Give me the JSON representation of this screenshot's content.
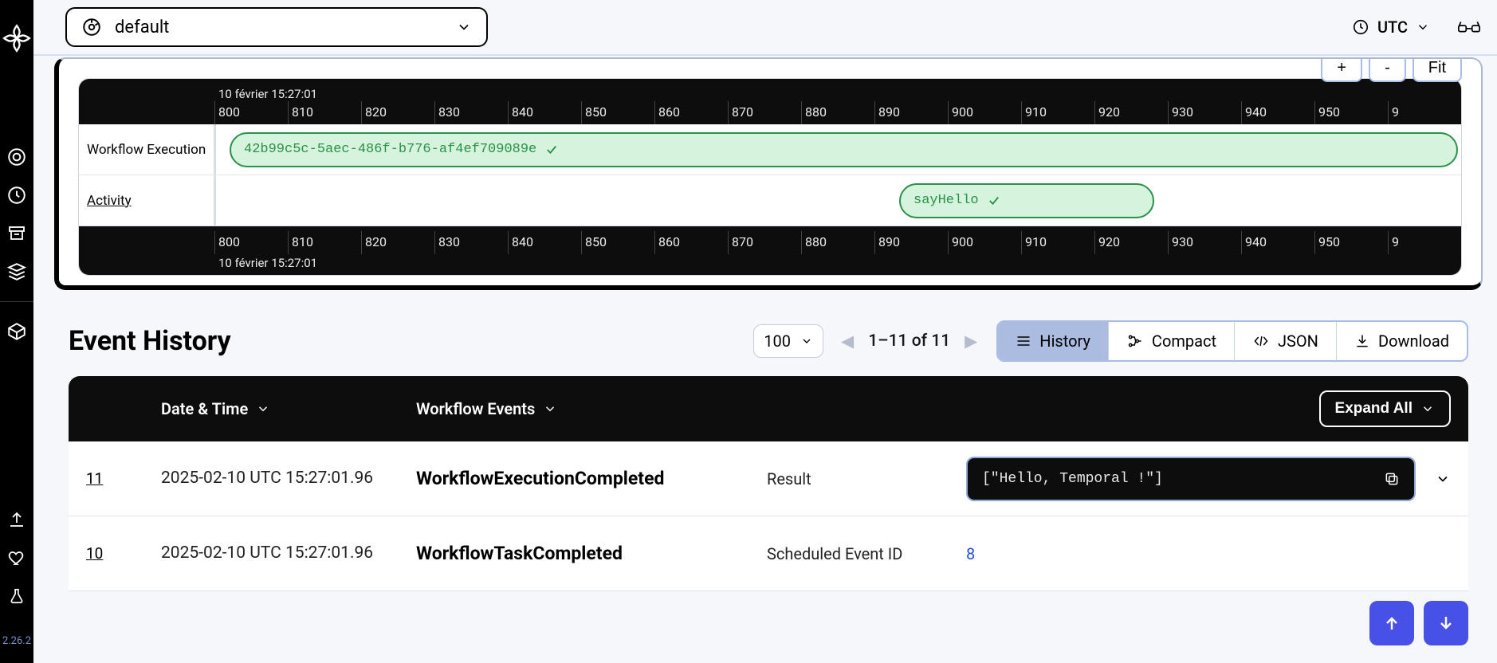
{
  "sidebar": {
    "version": "2.26.2"
  },
  "topbar": {
    "namespace": "default",
    "timezone": "UTC"
  },
  "zoom": {
    "plus": "+",
    "minus": "-",
    "fit": "Fit"
  },
  "timeline": {
    "date_label": "10 février 15:27:01",
    "ticks": [
      "800",
      "810",
      "820",
      "830",
      "840",
      "850",
      "860",
      "870",
      "880",
      "890",
      "900",
      "910",
      "920",
      "930",
      "940",
      "950",
      "9"
    ],
    "rows": {
      "workflow_label": "Workflow Execution",
      "workflow_id": "42b99c5c-5aec-486f-b776-af4ef709089e",
      "activity_label": "Activity",
      "activity_name": "sayHello"
    }
  },
  "history": {
    "title": "Event History",
    "page_size": "100",
    "range": "1–11 of 11",
    "tabs": {
      "history": "History",
      "compact": "Compact",
      "json": "JSON",
      "download": "Download"
    },
    "columns": {
      "date": "Date & Time",
      "events": "Workflow Events",
      "expand_all": "Expand All"
    },
    "rows": [
      {
        "id": "11",
        "datetime": "2025-02-10 UTC 15:27:01.96",
        "event": "WorkflowExecutionCompleted",
        "key": "Result",
        "value": "[\"Hello, Temporal !\"]",
        "value_is_code": true
      },
      {
        "id": "10",
        "datetime": "2025-02-10 UTC 15:27:01.96",
        "event": "WorkflowTaskCompleted",
        "key": "Scheduled Event ID",
        "value": "8",
        "value_is_code": false
      }
    ]
  }
}
